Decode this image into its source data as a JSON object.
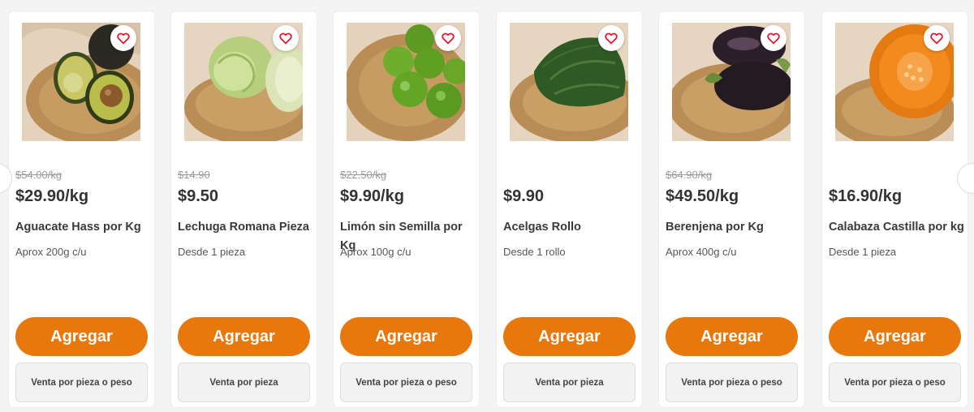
{
  "products": [
    {
      "name": "Aguacate Hass por Kg",
      "old_price": "$54.00/kg",
      "price": "$29.90/kg",
      "description": "Aprox 200g c/u",
      "add_label": "Agregar",
      "sale_type": "Venta por pieza o peso",
      "image": "avocado"
    },
    {
      "name": "Lechuga Romana Pieza",
      "old_price": "$14.90",
      "price": "$9.50",
      "description": "Desde 1 pieza",
      "add_label": "Agregar",
      "sale_type": "Venta por pieza",
      "image": "lettuce"
    },
    {
      "name": "Limón sin Semilla por Kg",
      "old_price": "$22.50/kg",
      "price": "$9.90/kg",
      "description": "Aprox 100g c/u",
      "add_label": "Agregar",
      "sale_type": "Venta por pieza o peso",
      "image": "limes"
    },
    {
      "name": "Acelgas Rollo",
      "old_price": "",
      "price": "$9.90",
      "description": "Desde 1 rollo",
      "add_label": "Agregar",
      "sale_type": "Venta por pieza",
      "image": "chard"
    },
    {
      "name": "Berenjena por Kg",
      "old_price": "$64.90/kg",
      "price": "$49.50/kg",
      "description": "Aprox 400g c/u",
      "add_label": "Agregar",
      "sale_type": "Venta por pieza o peso",
      "image": "eggplant"
    },
    {
      "name": "Calabaza Castilla por kg",
      "old_price": "",
      "price": "$16.90/kg",
      "description": "Desde 1 pieza",
      "add_label": "Agregar",
      "sale_type": "Venta por pieza o peso",
      "image": "pumpkin"
    }
  ],
  "colors": {
    "accent": "#e8780c",
    "favorite": "#e0192f",
    "old_price": "#9a9a9a",
    "price": "#333333"
  },
  "icons": {
    "favorite": "heart-outline-icon",
    "prev": "carousel-prev-arrow",
    "next": "carousel-next-arrow"
  }
}
